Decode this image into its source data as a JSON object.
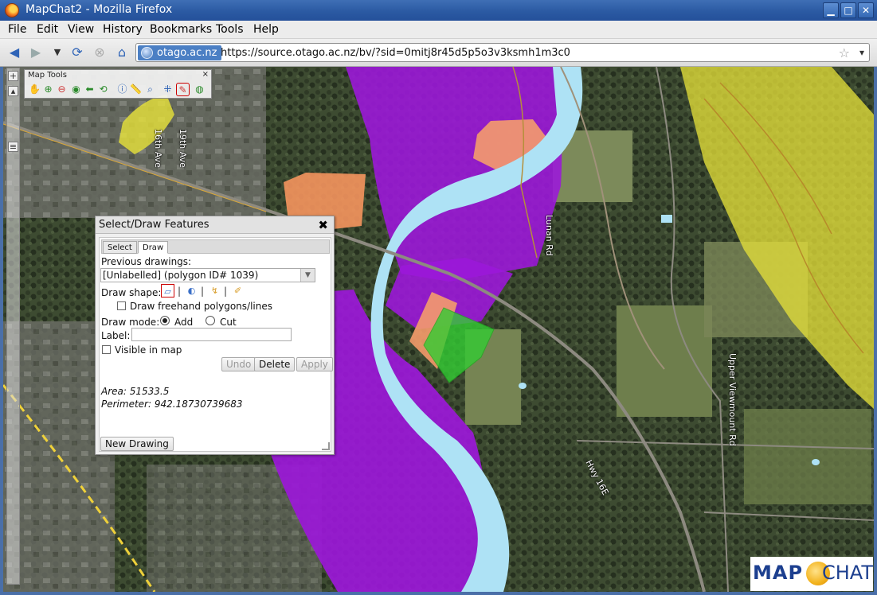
{
  "window": {
    "title": "MapChat2 - Mozilla Firefox",
    "min": "▁",
    "max": "□",
    "close": "✕"
  },
  "menubar": {
    "items": [
      "File",
      "Edit",
      "View",
      "History",
      "Bookmarks",
      "Tools",
      "Help"
    ]
  },
  "navbar": {
    "site_identity": "otago.ac.nz",
    "url": "https://source.otago.ac.nz/bv/?sid=0mitj8r45d5p5o3v3ksmh1m3c0",
    "icons": [
      "back-arrow-icon",
      "forward-arrow-icon",
      "history-dropdown-icon",
      "reload-icon",
      "stop-icon",
      "home-icon",
      "star-icon"
    ]
  },
  "map": {
    "road_labels": [
      "16th Ave",
      "19th Ave",
      "Lunan Rd",
      "Hwy 16E",
      "Upper Viewmount Rd"
    ],
    "tools_title": "Map Tools",
    "tools_close": "×",
    "colors": {
      "river": "#aee2f5",
      "purple": "#9b18d8",
      "yellow": "#e8e33a",
      "orange": "#f59c6b",
      "green": "#33cc33"
    }
  },
  "dialog": {
    "title": "Select/Draw Features",
    "close": "✖",
    "tabs": [
      "Select",
      "Draw"
    ],
    "previous_label": "Previous drawings:",
    "previous_value": "[Unlabelled] (polygon ID# 1039)",
    "shape_label": "Draw shape:",
    "freehand_label": "Draw freehand polygons/lines",
    "mode_label": "Draw mode:",
    "mode_add": "Add",
    "mode_cut": "Cut",
    "label_label": "Label:",
    "visible_label": "Visible in map",
    "undo": "Undo",
    "delete": "Delete",
    "apply": "Apply",
    "area": "Area: 51533.5",
    "perimeter": "Perimeter: 942.18730739683",
    "new_drawing": "New Drawing"
  },
  "logo": {
    "left": "MAP",
    "right": "CHAT"
  }
}
